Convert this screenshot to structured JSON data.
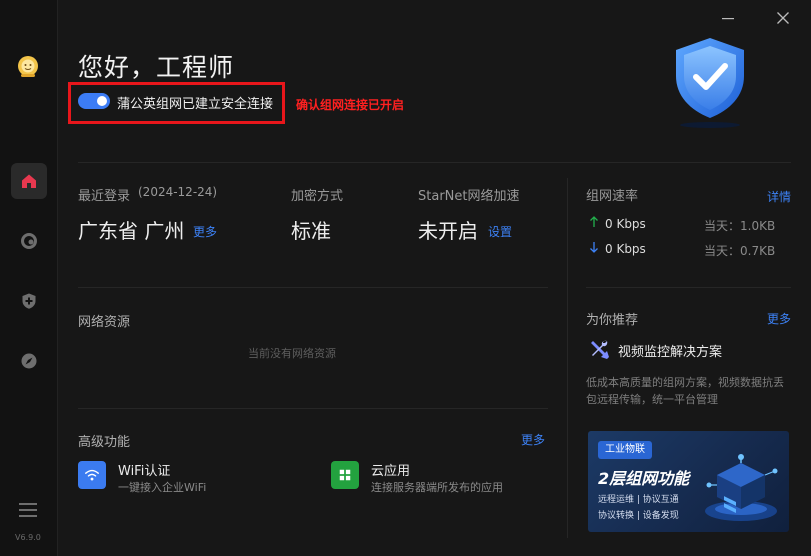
{
  "app": {
    "version": "V6.9.0"
  },
  "header": {
    "greeting": "您好，工程师",
    "status": "蒲公英组网已建立安全连接",
    "annotation": "确认组网连接已开启",
    "toggle_on": true
  },
  "stats": {
    "last_login_label": "最近登录",
    "last_login_date": "(2024-12-24)",
    "location": "广东省 广州",
    "more": "更多",
    "encryption_label": "加密方式",
    "encryption_value": "标准",
    "accel_label": "StarNet网络加速",
    "accel_value": "未开启",
    "accel_link": "设置"
  },
  "speed": {
    "title": "组网速率",
    "detail_link": "详情",
    "up": "0 Kbps",
    "down": "0 Kbps",
    "today_up": "当天：1.0KB",
    "today_down": "当天：0.7KB"
  },
  "resources": {
    "title": "网络资源",
    "empty": "当前没有网络资源"
  },
  "recommend": {
    "title": "为你推荐",
    "more": "更多",
    "item_title": "视频监控解决方案",
    "item_desc": "低成本高质量的组网方案，视频数据抗丢包远程传输，统一平台管理"
  },
  "advanced": {
    "title": "高级功能",
    "more": "更多",
    "items": [
      {
        "title": "WiFi认证",
        "subtitle": "一键接入企业WiFi",
        "icon": "wifi-icon",
        "color": "#3b7bf0"
      },
      {
        "title": "云应用",
        "subtitle": "连接服务器端所发布的应用",
        "icon": "apps-grid-icon",
        "color": "#23a23f"
      }
    ]
  },
  "banner": {
    "tag": "工业物联",
    "title": "2层组网功能",
    "line1": "远程运维 | 协议互通",
    "line2": "协议转换 | 设备发现"
  },
  "colors": {
    "accent": "#3d82f6",
    "annotation": "#ff2020",
    "up_arrow": "#23b14d",
    "down_arrow": "#3d82f6"
  }
}
